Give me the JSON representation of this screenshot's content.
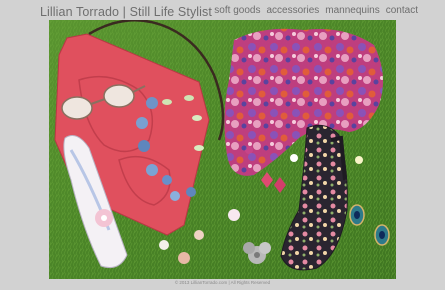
{
  "header": {
    "site_title": "Lillian Torrado | Still Life Stylist",
    "nav": [
      {
        "label": "soft goods"
      },
      {
        "label": "accessories"
      },
      {
        "label": "mannequins"
      },
      {
        "label": "contact"
      }
    ]
  },
  "footer": {
    "copyright": "© 2013 LillianTorrado.com | All Rights Reserved"
  },
  "colors": {
    "background": "#d2d2d2",
    "text": "#6e6e6e",
    "grass": "#4f8a2a",
    "bag": "#e0505e"
  }
}
